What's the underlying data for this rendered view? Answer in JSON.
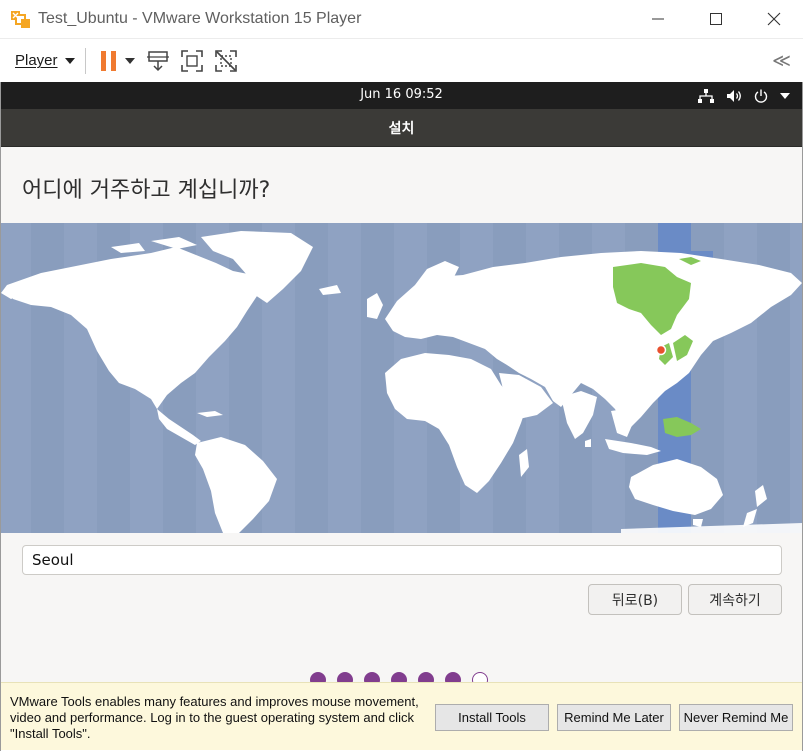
{
  "window": {
    "title": "Test_Ubuntu - VMware Workstation 15 Player",
    "app_icon": "vmware-player-icon",
    "controls": [
      "minimize-icon",
      "maximize-icon",
      "close-icon"
    ]
  },
  "toolbar": {
    "player_label": "Player",
    "icons": [
      "pause-icon",
      "dropdown-caret-icon",
      "send-ctrl-alt-del-icon",
      "fullscreen-icon",
      "unity-icon",
      "collapse-icon"
    ],
    "accent": "#f07a30"
  },
  "guest": {
    "topbar": {
      "clock": "Jun 16  09:52",
      "tray_icons": [
        "network-icon",
        "volume-icon",
        "power-icon",
        "menu-caret-icon"
      ]
    },
    "header_title": "설치",
    "heading": "어디에 거주하고 계십니까?",
    "timezone_value": "Seoul",
    "back_button": "뒤로(B)",
    "continue_button": "계속하기",
    "progress": {
      "total": 7,
      "completed": 6
    },
    "colors": {
      "ocean": "#8fa2c2",
      "land": "#ffffff",
      "selected_zone": "#86c85a",
      "selected_band": "#6a8bc6",
      "marker": "#e8502e",
      "progress_dot": "#813d8e"
    }
  },
  "vmtools": {
    "message": "VMware Tools enables many features and improves mouse movement, video and performance. Log in to the guest operating system and click \"Install Tools\".",
    "install_button": "Install Tools",
    "remind_button": "Remind Me Later",
    "never_button": "Never Remind Me"
  }
}
